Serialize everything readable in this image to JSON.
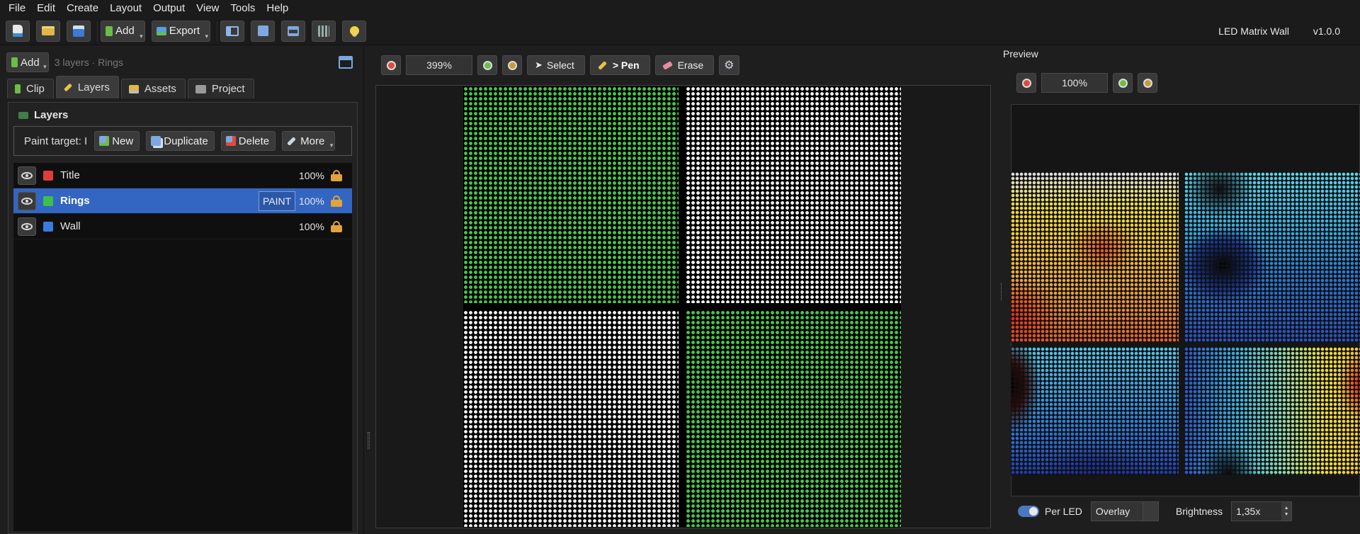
{
  "menu": [
    "File",
    "Edit",
    "Create",
    "Layout",
    "Output",
    "View",
    "Tools",
    "Help"
  ],
  "toolbar": {
    "add_label": "Add",
    "export_label": "Export",
    "app_title": "LED Matrix Wall",
    "version": "v1.0.0"
  },
  "left": {
    "add_label": "Add",
    "summary": "3 layers · Rings",
    "tabs": [
      "Clip",
      "Layers",
      "Assets",
      "Project"
    ],
    "active_tab": "Layers",
    "layers_title": "Layers",
    "paint_target_label": "Paint target: I",
    "buttons": {
      "new": "New",
      "duplicate": "Duplicate",
      "delete": "Delete",
      "more": "More"
    },
    "layers": [
      {
        "name": "Title",
        "color": "#e03c3c",
        "opacity": "100%",
        "selected": false
      },
      {
        "name": "Rings",
        "color": "#3cc04a",
        "opacity": "100%",
        "selected": true,
        "badge": "PAINT"
      },
      {
        "name": "Wall",
        "color": "#3b7be0",
        "opacity": "100%",
        "selected": false
      }
    ]
  },
  "editor": {
    "zoom": "399%",
    "tools": {
      "select": "Select",
      "pen": "> Pen",
      "erase": "Erase"
    },
    "active_tool": "Pen",
    "quadrant_colors": {
      "top_left": "#46c84a",
      "top_right": "#f2f2f2",
      "bottom_left": "#f2f2f2",
      "bottom_right": "#46c84a"
    }
  },
  "preview": {
    "title": "Preview",
    "zoom": "100%",
    "per_led_label": "Per LED",
    "per_led_on": true,
    "blend_mode": "Overlay",
    "brightness_label": "Brightness",
    "brightness": "1,35x"
  }
}
